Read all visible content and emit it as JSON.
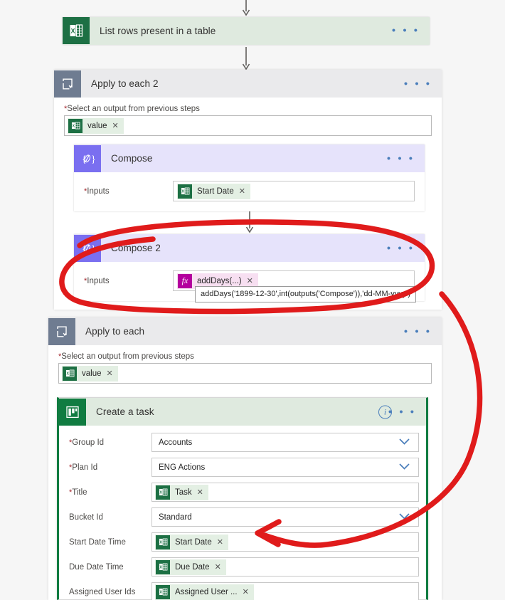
{
  "canvas": {
    "background": "#f6f6f6",
    "accent_blue": "#4a7ebb",
    "excel_green": "#1d7044",
    "planner_green": "#107c41",
    "compose_purple": "#7a6ff0",
    "loop_gray": "#6f7c91",
    "annotation_red": "#e01b1b"
  },
  "nodes": {
    "excel_action": {
      "title": "List rows present in a table",
      "icon": "excel-icon",
      "menu": "• • •"
    },
    "apply_to_each_2": {
      "title": "Apply to each 2",
      "icon": "loop-icon",
      "menu": "• • •",
      "field_label": "Select an output from previous steps",
      "required_mark": "*",
      "token": {
        "text": "value",
        "icon": "excel-icon",
        "remove": "✕"
      }
    },
    "compose": {
      "title": "Compose",
      "icon": "compose-icon",
      "icon_glyph": "{⁄}",
      "menu": "• • •",
      "input_label": "Inputs",
      "required_mark": "*",
      "token": {
        "text": "Start Date",
        "icon": "excel-icon",
        "remove": "✕"
      }
    },
    "compose_2": {
      "title": "Compose 2",
      "icon": "compose-icon",
      "icon_glyph": "{⁄}",
      "menu": "• • •",
      "input_label": "Inputs",
      "required_mark": "*",
      "token": {
        "text": "addDays(...)",
        "icon": "function-icon",
        "icon_glyph": "fx",
        "remove": "✕"
      },
      "tooltip": "addDays('1899-12-30',int(outputs('Compose')),'dd-MM-yyyy')"
    },
    "apply_to_each": {
      "title": "Apply to each",
      "icon": "loop-icon",
      "menu": "• • •",
      "field_label": "Select an output from previous steps",
      "required_mark": "*",
      "token": {
        "text": "value",
        "icon": "excel-icon",
        "remove": "✕"
      }
    },
    "create_a_task": {
      "title": "Create a task",
      "icon": "planner-icon",
      "menu": "• • •",
      "info": "i",
      "fields": [
        {
          "label": "Group Id",
          "required": true,
          "type": "dropdown",
          "value": "Accounts"
        },
        {
          "label": "Plan Id",
          "required": true,
          "type": "dropdown",
          "value": "ENG Actions"
        },
        {
          "label": "Title",
          "required": true,
          "type": "token",
          "value": "Task",
          "token_icon": "excel-icon",
          "remove": "✕"
        },
        {
          "label": "Bucket Id",
          "required": false,
          "type": "dropdown",
          "value": "Standard"
        },
        {
          "label": "Start Date Time",
          "required": false,
          "type": "token",
          "value": "Start Date",
          "token_icon": "excel-icon",
          "remove": "✕"
        },
        {
          "label": "Due Date Time",
          "required": false,
          "type": "token",
          "value": "Due Date",
          "token_icon": "excel-icon",
          "remove": "✕"
        },
        {
          "label": "Assigned User Ids",
          "required": false,
          "type": "token",
          "value": "Assigned User ...",
          "token_icon": "excel-icon",
          "remove": "✕"
        }
      ]
    }
  },
  "annotations": {
    "circle": {
      "name": "red-circle-highlight",
      "target": "compose_2"
    },
    "arrow": {
      "name": "red-arrow",
      "from": "compose_2",
      "to": "start-date-time-field"
    }
  }
}
